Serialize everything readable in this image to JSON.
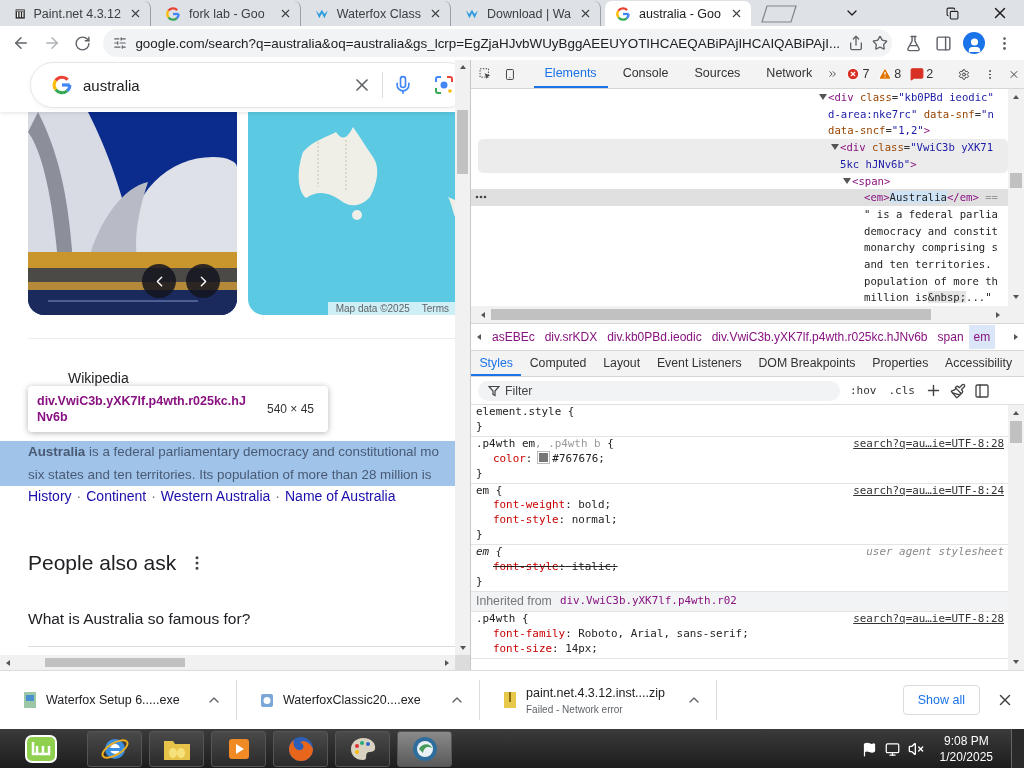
{
  "browser": {
    "tabs": [
      {
        "title": "Paint.net 4.3.12",
        "kind": "paint",
        "selected": false
      },
      {
        "title": "fork lab - Goo",
        "kind": "google",
        "selected": false
      },
      {
        "title": "Waterfox Class",
        "kind": "waterfox",
        "selected": false
      },
      {
        "title": "Download | Wa",
        "kind": "waterfox",
        "selected": false
      },
      {
        "title": "australia - Goo",
        "kind": "google",
        "selected": true
      }
    ],
    "address": "google.com/search?q=australia&oq=australia&gs_lcrp=EgZjaHJvbWUyBggAEEUYOTIHCAEQABiPAjIHCAIQABiPAjI..."
  },
  "page": {
    "search": {
      "value": "australia"
    },
    "map": {
      "attribution": "Map data ©2025",
      "terms": "Terms"
    },
    "result": {
      "source": "Wikipedia",
      "highlighted": true,
      "snippet": [
        "**Australia** is a federal parliamentary democracy and constitutional mo",
        "six states and ten territories. Its population of more than 28 million is"
      ],
      "links": [
        {
          "label": "History"
        },
        {
          "separator": "·",
          "label": "Continent"
        },
        {
          "separator": "·",
          "label": "Western Australia"
        },
        {
          "separator": "·",
          "label": "Name of Australia"
        }
      ]
    },
    "inspect_tooltip": {
      "selector": "div.VwiC3b.yXK7lf.p4wth.r025kc.hJNv6b",
      "size": "540 × 45"
    },
    "people_also_ask": {
      "heading": "People also ask",
      "questions": [
        "What is Australia so famous for?"
      ]
    }
  },
  "devtools": {
    "tabs": [
      {
        "label": "Elements",
        "selected": true
      },
      {
        "label": "Console",
        "selected": false
      },
      {
        "label": "Sources",
        "selected": false
      },
      {
        "label": "Network",
        "selected": false
      }
    ],
    "counts": [
      {
        "kind": "error",
        "value": "7"
      },
      {
        "kind": "warning",
        "value": "8"
      },
      {
        "kind": "issue",
        "value": "2"
      }
    ],
    "dom": [
      {
        "kind": "element",
        "expanded": true,
        "hovered": false,
        "selected": false,
        "lines": [
          [
            {
              "kind": "tag",
              "text": "<div"
            },
            {
              "kind": "attr",
              "text": " class"
            },
            {
              "kind": "punct",
              "text": "="
            },
            {
              "kind": "val",
              "text": "\"kb0PBd ieodic\""
            }
          ],
          [
            {
              "kind": "val",
              "text": "d-area:nke7rc\""
            },
            {
              "kind": "attr",
              "text": " data-snf"
            },
            {
              "kind": "punct",
              "text": "="
            },
            {
              "kind": "val",
              "text": "\"n"
            }
          ],
          [
            {
              "kind": "attr",
              "text": "data-sncf"
            },
            {
              "kind": "punct",
              "text": "="
            },
            {
              "kind": "val",
              "text": "\"1,2\""
            },
            {
              "kind": "tag",
              "text": ">"
            }
          ]
        ],
        "children": [
          {
            "kind": "element",
            "expanded": true,
            "hovered": true,
            "selected": false,
            "lines": [
              [
                {
                  "kind": "tag",
                  "text": "<div"
                },
                {
                  "kind": "attr",
                  "text": " class"
                },
                {
                  "kind": "punct",
                  "text": "="
                },
                {
                  "kind": "val",
                  "text": "\"VwiC3b yXK71"
                }
              ],
              [
                {
                  "kind": "val",
                  "text": "5kc hJNv6b\""
                },
                {
                  "kind": "tag",
                  "text": ">"
                }
              ]
            ],
            "children": [
              {
                "kind": "element",
                "expanded": true,
                "hovered": false,
                "selected": false,
                "lines": [
                  [
                    {
                      "kind": "tag",
                      "text": "<span>"
                    }
                  ]
                ],
                "children": [
                  {
                    "kind": "leaf",
                    "hovered": false,
                    "selected": true,
                    "lines": [
                      [
                        {
                          "kind": "tag",
                          "text": "<em>"
                        },
                        {
                          "kind": "hl",
                          "text": "Australia"
                        },
                        {
                          "kind": "tag",
                          "text": "</em>"
                        },
                        {
                          "kind": "dim",
                          "text": " =="
                        }
                      ]
                    ]
                  },
                  {
                    "kind": "leaf",
                    "hovered": false,
                    "selected": false,
                    "lines": [
                      [
                        {
                          "kind": "text",
                          "text": "\" is a federal parlia"
                        }
                      ],
                      [
                        {
                          "kind": "text",
                          "text": "democracy and constit"
                        }
                      ],
                      [
                        {
                          "kind": "text",
                          "text": "monarchy comprising s"
                        }
                      ],
                      [
                        {
                          "kind": "text",
                          "text": "and ten territories."
                        }
                      ],
                      [
                        {
                          "kind": "text",
                          "text": "population of more th"
                        }
                      ],
                      [
                        {
                          "kind": "text",
                          "text": "million is"
                        },
                        {
                          "kind": "entity",
                          "text": "&nbsp;"
                        },
                        {
                          "kind": "text",
                          "text": "...\""
                        }
                      ]
                    ]
                  }
                ]
              }
            ]
          }
        ]
      }
    ],
    "breadcrumbs": [
      {
        "label": "asEBEc",
        "selected": false
      },
      {
        "label": "div.srKDX",
        "selected": false
      },
      {
        "label": "div.kb0PBd.ieodic",
        "selected": false
      },
      {
        "label": "div.VwiC3b.yXK7lf.p4wth.r025kc.hJNv6b",
        "selected": false
      },
      {
        "label": "span",
        "selected": false
      },
      {
        "label": "em",
        "selected": true
      }
    ],
    "style_tabs": [
      {
        "label": "Styles",
        "selected": true
      },
      {
        "label": "Computed",
        "selected": false
      },
      {
        "label": "Layout",
        "selected": false
      },
      {
        "label": "Event Listeners",
        "selected": false
      },
      {
        "label": "DOM Breakpoints",
        "selected": false
      },
      {
        "label": "Properties",
        "selected": false
      },
      {
        "label": "Accessibility",
        "selected": false
      }
    ],
    "filter": {
      "placeholder": "Filter"
    },
    "toggles": [
      ":hov",
      ".cls"
    ],
    "rules": [
      {
        "kind": "rule",
        "selector": [
          {
            "kind": "sel",
            "text": "element.style"
          },
          {
            "kind": "sel",
            "text": " {"
          }
        ],
        "close": "}"
      },
      {
        "kind": "rule",
        "selector": [
          {
            "kind": "sel",
            "text": ".p4wth em"
          },
          {
            "kind": "dim",
            "text": ", .p4wth b"
          },
          {
            "kind": "sel",
            "text": " {"
          }
        ],
        "source": "search?q=au…ie=UTF-8:28",
        "close": "}",
        "props": [
          {
            "name": "color",
            "colon": ":",
            "color": "#767676",
            "value": "#767676;",
            "struck": false
          }
        ]
      },
      {
        "kind": "rule",
        "selector": [
          {
            "kind": "sel",
            "text": "em {"
          }
        ],
        "source": "search?q=au…ie=UTF-8:24",
        "close": "}",
        "props": [
          {
            "name": "font-weight",
            "colon": ":",
            "value": "bold;",
            "struck": false
          },
          {
            "name": "font-style",
            "colon": ":",
            "value": "normal;",
            "struck": false
          }
        ]
      },
      {
        "kind": "user-agent",
        "selector": [
          {
            "kind": "sel",
            "text": "em {"
          }
        ],
        "source": "user agent stylesheet",
        "close": "}",
        "props": [
          {
            "name": "font-style",
            "colon": ":",
            "value": "italic;",
            "struck": true
          }
        ]
      },
      {
        "kind": "inherited",
        "label": "Inherited from",
        "selector": "div.VwiC3b.yXK7lf.p4wth.r02"
      },
      {
        "kind": "rule",
        "selector": [
          {
            "kind": "sel",
            "text": ".p4wth {"
          }
        ],
        "source": "search?q=au…ie=UTF-8:28",
        "props": [
          {
            "name": "font-family",
            "colon": ":",
            "value": "Roboto, Arial, sans-serif;",
            "struck": false
          },
          {
            "name": "font-size",
            "colon": ":",
            "value": "14px;",
            "struck": false
          }
        ]
      }
    ]
  },
  "downloads": {
    "items": [
      {
        "name": "Waterfox Setup 6.....exe",
        "kind": "installer"
      },
      {
        "name": "WaterfoxClassic20....exe",
        "kind": "setup"
      },
      {
        "name": "paint.net.4.3.12.inst....zip",
        "kind": "archive",
        "status": "Failed - Network error"
      }
    ],
    "show_all": "Show all"
  },
  "taskbar": {
    "apps": [
      {
        "kind": "start",
        "selected": false
      },
      {
        "kind": "ie",
        "selected": false
      },
      {
        "kind": "folder",
        "selected": false
      },
      {
        "kind": "media",
        "selected": false
      },
      {
        "kind": "firefox",
        "selected": false
      },
      {
        "kind": "paint",
        "selected": false
      },
      {
        "kind": "waterfox",
        "selected": true
      }
    ],
    "time": "9:08 PM",
    "date": "1/20/2025"
  }
}
